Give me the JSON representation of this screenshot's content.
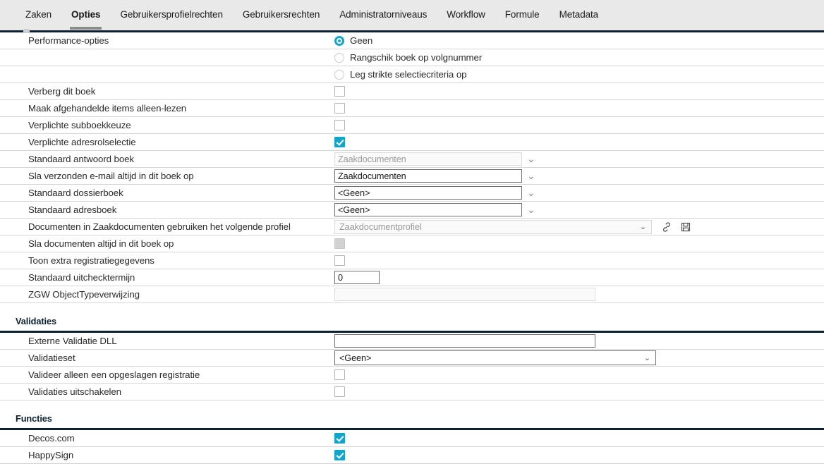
{
  "tabs": [
    {
      "label": "Zaken",
      "active": false
    },
    {
      "label": "Opties",
      "active": true
    },
    {
      "label": "Gebruikersprofielrechten",
      "active": false
    },
    {
      "label": "Gebruikersrechten",
      "active": false
    },
    {
      "label": "Administratorniveaus",
      "active": false
    },
    {
      "label": "Workflow",
      "active": false
    },
    {
      "label": "Formule",
      "active": false
    },
    {
      "label": "Metadata",
      "active": false
    }
  ],
  "colors": {
    "accent": "#12a5cc",
    "header_rule": "#0b2030",
    "tabbar_bg": "#e9e9e9",
    "tab_underline": "#8c8c8c",
    "row_divider": "#d7d7d7"
  },
  "performance": {
    "label": "Performance-opties",
    "options": [
      {
        "label": "Geen",
        "selected": true
      },
      {
        "label": "Rangschik boek op volgnummer",
        "selected": false
      },
      {
        "label": "Leg strikte selectiecriteria op",
        "selected": false
      }
    ]
  },
  "checkbox_rows": [
    {
      "label": "Verberg dit boek",
      "checked": false,
      "disabled": false
    },
    {
      "label": "Maak afgehandelde items alleen-lezen",
      "checked": false,
      "disabled": false
    },
    {
      "label": "Verplichte subboekkeuze",
      "checked": false,
      "disabled": false
    },
    {
      "label": "Verplichte adresrolselectie",
      "checked": true,
      "disabled": false
    }
  ],
  "book_selects": [
    {
      "label": "Standaard antwoord boek",
      "value": "Zaakdocumenten",
      "readonly": true
    },
    {
      "label": "Sla verzonden e-mail altijd in dit boek op",
      "value": "Zaakdocumenten",
      "readonly": false
    },
    {
      "label": "Standaard dossierboek",
      "value": "<Geen>",
      "readonly": false
    },
    {
      "label": "Standaard adresboek",
      "value": "<Geen>",
      "readonly": false
    }
  ],
  "profile_row": {
    "label": "Documenten in Zaakdocumenten gebruiken het volgende profiel",
    "value": "Zaakdocumentprofiel",
    "link_icon": "link-icon",
    "save_icon": "save-icon"
  },
  "always_save_row": {
    "label": "Sla documenten altijd in dit boek op",
    "checked": false,
    "disabled": true
  },
  "extra_reg_row": {
    "label": "Toon extra registratiegegevens",
    "checked": false
  },
  "checkout_row": {
    "label": "Standaard uitchecktermijn",
    "value": "0"
  },
  "zgw_row": {
    "label": "ZGW ObjectTypeverwijzing",
    "value": ""
  },
  "validaties": {
    "title": "Validaties",
    "dll_row": {
      "label": "Externe Validatie DLL",
      "value": ""
    },
    "set_row": {
      "label": "Validatieset",
      "value": "<Geen>"
    },
    "checks": [
      {
        "label": "Valideer alleen een opgeslagen registratie",
        "checked": false
      },
      {
        "label": "Validaties uitschakelen",
        "checked": false
      }
    ]
  },
  "functies": {
    "title": "Functies",
    "items": [
      {
        "label": "Decos.com",
        "checked": true
      },
      {
        "label": "HappySign",
        "checked": true
      }
    ]
  },
  "glyphs": {
    "chevron_down": "⌄",
    "select_arrow": "⌄"
  }
}
